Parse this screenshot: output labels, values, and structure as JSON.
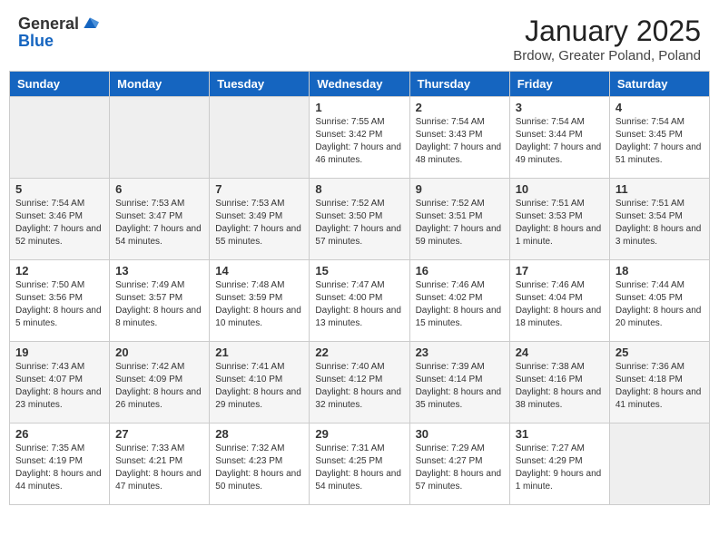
{
  "header": {
    "logo_general": "General",
    "logo_blue": "Blue",
    "title": "January 2025",
    "subtitle": "Brdow, Greater Poland, Poland"
  },
  "weekdays": [
    "Sunday",
    "Monday",
    "Tuesday",
    "Wednesday",
    "Thursday",
    "Friday",
    "Saturday"
  ],
  "weeks": [
    [
      {
        "num": "",
        "info": "",
        "empty": true
      },
      {
        "num": "",
        "info": "",
        "empty": true
      },
      {
        "num": "",
        "info": "",
        "empty": true
      },
      {
        "num": "1",
        "info": "Sunrise: 7:55 AM\nSunset: 3:42 PM\nDaylight: 7 hours and 46 minutes.",
        "empty": false
      },
      {
        "num": "2",
        "info": "Sunrise: 7:54 AM\nSunset: 3:43 PM\nDaylight: 7 hours and 48 minutes.",
        "empty": false
      },
      {
        "num": "3",
        "info": "Sunrise: 7:54 AM\nSunset: 3:44 PM\nDaylight: 7 hours and 49 minutes.",
        "empty": false
      },
      {
        "num": "4",
        "info": "Sunrise: 7:54 AM\nSunset: 3:45 PM\nDaylight: 7 hours and 51 minutes.",
        "empty": false
      }
    ],
    [
      {
        "num": "5",
        "info": "Sunrise: 7:54 AM\nSunset: 3:46 PM\nDaylight: 7 hours and 52 minutes.",
        "empty": false
      },
      {
        "num": "6",
        "info": "Sunrise: 7:53 AM\nSunset: 3:47 PM\nDaylight: 7 hours and 54 minutes.",
        "empty": false
      },
      {
        "num": "7",
        "info": "Sunrise: 7:53 AM\nSunset: 3:49 PM\nDaylight: 7 hours and 55 minutes.",
        "empty": false
      },
      {
        "num": "8",
        "info": "Sunrise: 7:52 AM\nSunset: 3:50 PM\nDaylight: 7 hours and 57 minutes.",
        "empty": false
      },
      {
        "num": "9",
        "info": "Sunrise: 7:52 AM\nSunset: 3:51 PM\nDaylight: 7 hours and 59 minutes.",
        "empty": false
      },
      {
        "num": "10",
        "info": "Sunrise: 7:51 AM\nSunset: 3:53 PM\nDaylight: 8 hours and 1 minute.",
        "empty": false
      },
      {
        "num": "11",
        "info": "Sunrise: 7:51 AM\nSunset: 3:54 PM\nDaylight: 8 hours and 3 minutes.",
        "empty": false
      }
    ],
    [
      {
        "num": "12",
        "info": "Sunrise: 7:50 AM\nSunset: 3:56 PM\nDaylight: 8 hours and 5 minutes.",
        "empty": false
      },
      {
        "num": "13",
        "info": "Sunrise: 7:49 AM\nSunset: 3:57 PM\nDaylight: 8 hours and 8 minutes.",
        "empty": false
      },
      {
        "num": "14",
        "info": "Sunrise: 7:48 AM\nSunset: 3:59 PM\nDaylight: 8 hours and 10 minutes.",
        "empty": false
      },
      {
        "num": "15",
        "info": "Sunrise: 7:47 AM\nSunset: 4:00 PM\nDaylight: 8 hours and 13 minutes.",
        "empty": false
      },
      {
        "num": "16",
        "info": "Sunrise: 7:46 AM\nSunset: 4:02 PM\nDaylight: 8 hours and 15 minutes.",
        "empty": false
      },
      {
        "num": "17",
        "info": "Sunrise: 7:46 AM\nSunset: 4:04 PM\nDaylight: 8 hours and 18 minutes.",
        "empty": false
      },
      {
        "num": "18",
        "info": "Sunrise: 7:44 AM\nSunset: 4:05 PM\nDaylight: 8 hours and 20 minutes.",
        "empty": false
      }
    ],
    [
      {
        "num": "19",
        "info": "Sunrise: 7:43 AM\nSunset: 4:07 PM\nDaylight: 8 hours and 23 minutes.",
        "empty": false
      },
      {
        "num": "20",
        "info": "Sunrise: 7:42 AM\nSunset: 4:09 PM\nDaylight: 8 hours and 26 minutes.",
        "empty": false
      },
      {
        "num": "21",
        "info": "Sunrise: 7:41 AM\nSunset: 4:10 PM\nDaylight: 8 hours and 29 minutes.",
        "empty": false
      },
      {
        "num": "22",
        "info": "Sunrise: 7:40 AM\nSunset: 4:12 PM\nDaylight: 8 hours and 32 minutes.",
        "empty": false
      },
      {
        "num": "23",
        "info": "Sunrise: 7:39 AM\nSunset: 4:14 PM\nDaylight: 8 hours and 35 minutes.",
        "empty": false
      },
      {
        "num": "24",
        "info": "Sunrise: 7:38 AM\nSunset: 4:16 PM\nDaylight: 8 hours and 38 minutes.",
        "empty": false
      },
      {
        "num": "25",
        "info": "Sunrise: 7:36 AM\nSunset: 4:18 PM\nDaylight: 8 hours and 41 minutes.",
        "empty": false
      }
    ],
    [
      {
        "num": "26",
        "info": "Sunrise: 7:35 AM\nSunset: 4:19 PM\nDaylight: 8 hours and 44 minutes.",
        "empty": false
      },
      {
        "num": "27",
        "info": "Sunrise: 7:33 AM\nSunset: 4:21 PM\nDaylight: 8 hours and 47 minutes.",
        "empty": false
      },
      {
        "num": "28",
        "info": "Sunrise: 7:32 AM\nSunset: 4:23 PM\nDaylight: 8 hours and 50 minutes.",
        "empty": false
      },
      {
        "num": "29",
        "info": "Sunrise: 7:31 AM\nSunset: 4:25 PM\nDaylight: 8 hours and 54 minutes.",
        "empty": false
      },
      {
        "num": "30",
        "info": "Sunrise: 7:29 AM\nSunset: 4:27 PM\nDaylight: 8 hours and 57 minutes.",
        "empty": false
      },
      {
        "num": "31",
        "info": "Sunrise: 7:27 AM\nSunset: 4:29 PM\nDaylight: 9 hours and 1 minute.",
        "empty": false
      },
      {
        "num": "",
        "info": "",
        "empty": true
      }
    ]
  ]
}
